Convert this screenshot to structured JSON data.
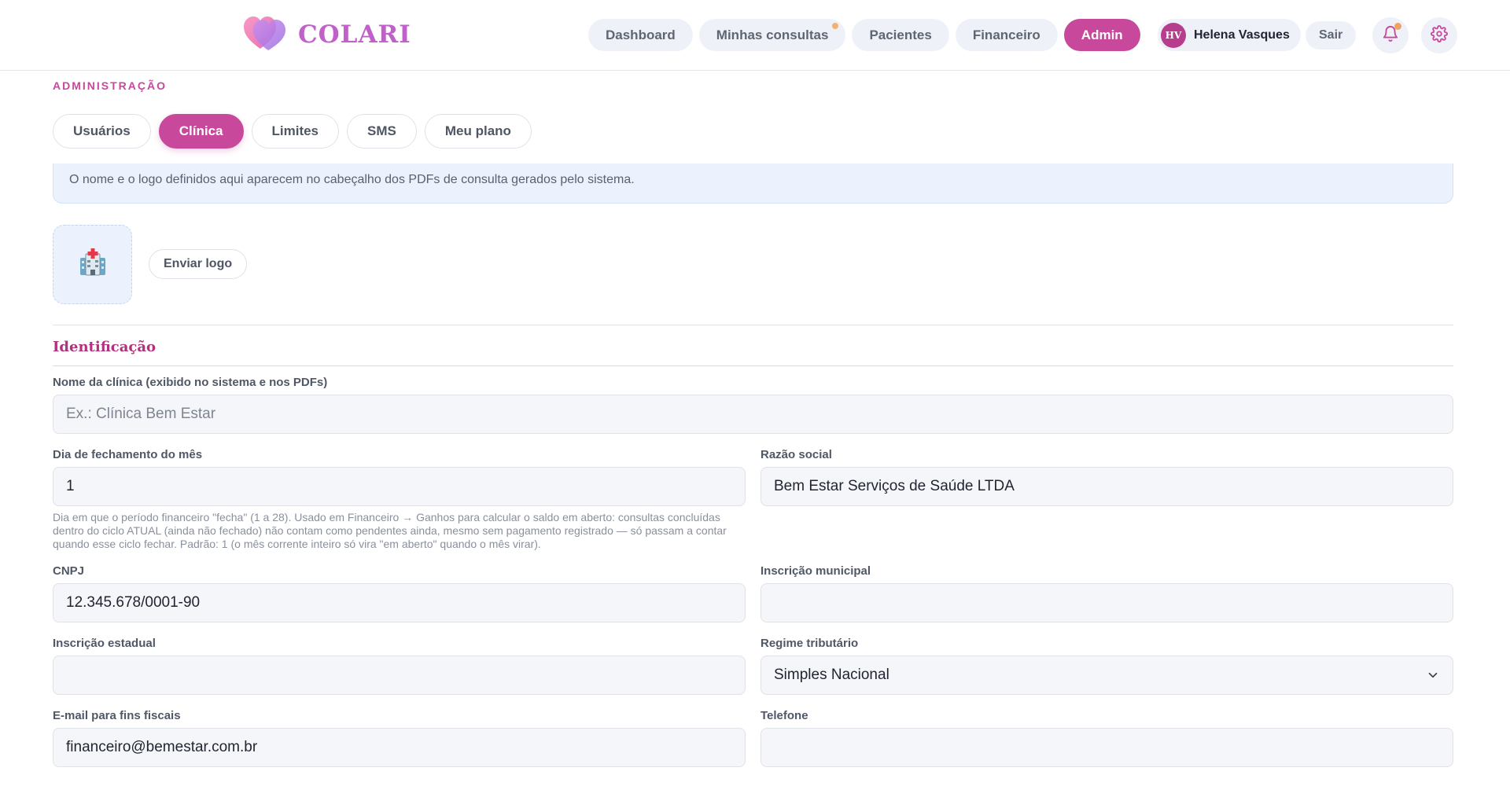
{
  "brand": {
    "name": "COLARI",
    "accent": "#c8489b",
    "logo_icon": "double-heart-icon"
  },
  "nav": {
    "items": [
      {
        "label": "Dashboard",
        "active": false,
        "has_dot": false
      },
      {
        "label": "Minhas consultas",
        "active": false,
        "has_dot": true
      },
      {
        "label": "Pacientes",
        "active": false,
        "has_dot": false
      },
      {
        "label": "Financeiro",
        "active": false,
        "has_dot": false
      },
      {
        "label": "Admin",
        "active": true,
        "has_dot": false
      }
    ]
  },
  "user": {
    "initials": "HV",
    "name": "Helena Vasques"
  },
  "actions": {
    "logout_label": "Sair",
    "notifications_icon": "bell-icon",
    "settings_icon": "gear-icon"
  },
  "page": {
    "kicker": "ADMINISTRAÇÃO",
    "tabs": [
      {
        "label": "Usuários",
        "active": false
      },
      {
        "label": "Clínica",
        "active": true
      },
      {
        "label": "Limites",
        "active": false
      },
      {
        "label": "SMS",
        "active": false
      },
      {
        "label": "Meu plano",
        "active": false
      }
    ],
    "info": "O nome e o logo definidos aqui aparecem no cabeçalho dos PDFs de consulta gerados pelo sistema.",
    "logo_placeholder_icon": "hospital-icon",
    "upload_label": "Enviar logo"
  },
  "form": {
    "group_title": "Identificação",
    "clinic_name": {
      "label": "Nome da clínica (exibido no sistema e nos PDFs)",
      "value": "",
      "placeholder": "Ex.: Clínica Bem Estar"
    },
    "closing_day": {
      "label": "Dia de fechamento do mês",
      "value": "1",
      "help": "Dia em que o período financeiro \"fecha\" (1 a 28). Usado em Financeiro → Ganhos para calcular o saldo em aberto: consultas concluídas dentro do ciclo ATUAL (ainda não fechado) não contam como pendentes ainda, mesmo sem pagamento registrado — só passam a contar quando esse ciclo fechar. Padrão: 1 (o mês corrente inteiro só vira \"em aberto\" quando o mês virar)."
    },
    "legal_name": {
      "label": "Razão social",
      "value": "Bem Estar Serviços de Saúde LTDA"
    },
    "cnpj": {
      "label": "CNPJ",
      "value": "12.345.678/0001-90"
    },
    "municipal_reg": {
      "label": "Inscrição municipal",
      "value": ""
    },
    "state_reg": {
      "label": "Inscrição estadual",
      "value": ""
    },
    "tax_regime": {
      "label": "Regime tributário",
      "value": "Simples Nacional"
    },
    "fiscal_email": {
      "label": "E-mail para fins fiscais",
      "value": "financeiro@bemestar.com.br"
    },
    "phone": {
      "label": "Telefone",
      "value": ""
    }
  }
}
